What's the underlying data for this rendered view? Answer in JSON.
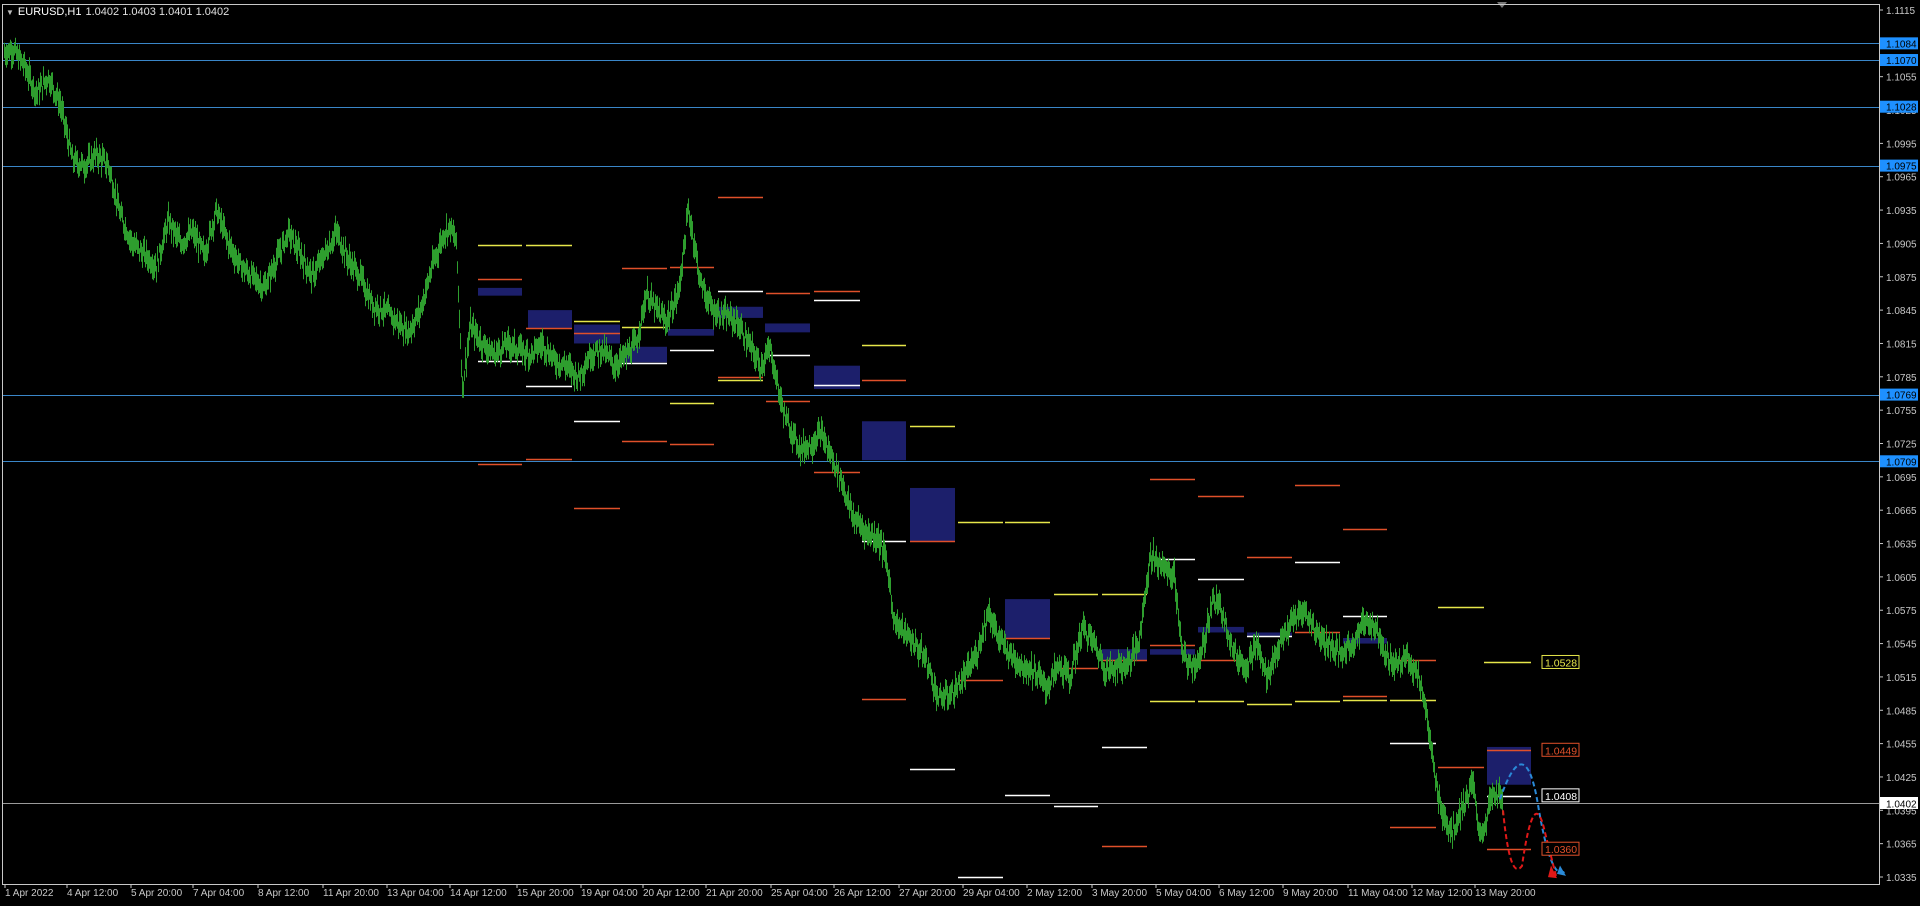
{
  "window": {
    "symbol_period": "EURUSD,H1",
    "ohlc": "1.0402 1.0403 1.0401 1.0402",
    "menu_icon": "dropdown-triangle-icon"
  },
  "colors": {
    "background": "#000000",
    "candles": "#2e9e2e",
    "hline": "#3a86c8",
    "price_tag": "#1e90ff",
    "box": "#1c1f6b",
    "yellow": "#e6e64a",
    "orange": "#e0502a",
    "white": "#ffffff",
    "blue_path": "#2a8ad8",
    "red_path": "#e01818"
  },
  "price_axis": {
    "min": 1.0325,
    "max": 1.1125,
    "ticks": [
      "1.1115",
      "1.1085",
      "1.1055",
      "1.1025",
      "1.0995",
      "1.0965",
      "1.0935",
      "1.0905",
      "1.0875",
      "1.0845",
      "1.0815",
      "1.0785",
      "1.0755",
      "1.0725",
      "1.0695",
      "1.0665",
      "1.0635",
      "1.0605",
      "1.0575",
      "1.0545",
      "1.0515",
      "1.0485",
      "1.0455",
      "1.0425",
      "1.0395",
      "1.0365",
      "1.0335"
    ]
  },
  "time_axis": {
    "labels": [
      "1 Apr 2022",
      "4 Apr 12:00",
      "5 Apr 20:00",
      "7 Apr 04:00",
      "8 Apr 12:00",
      "11 Apr 20:00",
      "13 Apr 04:00",
      "14 Apr 12:00",
      "15 Apr 20:00",
      "19 Apr 04:00",
      "20 Apr 12:00",
      "21 Apr 20:00",
      "25 Apr 04:00",
      "26 Apr 12:00",
      "27 Apr 20:00",
      "29 Apr 04:00",
      "2 May 12:00",
      "3 May 20:00",
      "5 May 04:00",
      "6 May 12:00",
      "9 May 20:00",
      "11 May 04:00",
      "12 May 12:00",
      "13 May 20:00"
    ]
  },
  "horizontal_levels": [
    {
      "price": 1.1085,
      "tag": "1.1084"
    },
    {
      "price": 1.107,
      "tag": "1.1070"
    },
    {
      "price": 1.1028,
      "tag": "1.1028"
    },
    {
      "price": 1.0975,
      "tag": "1.0975"
    },
    {
      "price": 1.0769,
      "tag": "1.0769"
    },
    {
      "price": 1.0709,
      "tag": "1.0709"
    }
  ],
  "current_price": {
    "price": 1.0402,
    "tag": "1.0402"
  },
  "projection_labels": [
    {
      "price": 1.0528,
      "text": "1.0528",
      "color": "#e6e64a"
    },
    {
      "price": 1.0449,
      "text": "1.0449",
      "color": "#e0502a"
    },
    {
      "price": 1.0408,
      "text": "1.0408",
      "color": "#ffffff"
    },
    {
      "price": 1.036,
      "text": "1.0360",
      "color": "#e0502a"
    }
  ],
  "chart_data": {
    "type": "candlestick",
    "instrument": "EURUSD",
    "timeframe": "H1",
    "ylim": [
      1.0325,
      1.1125
    ],
    "price_path": [
      [
        0,
        1.1075
      ],
      [
        12,
        1.108
      ],
      [
        24,
        1.1065
      ],
      [
        36,
        1.104
      ],
      [
        48,
        1.1055
      ],
      [
        60,
        1.103
      ],
      [
        72,
        1.098
      ],
      [
        84,
        1.0975
      ],
      [
        96,
        1.0985
      ],
      [
        108,
        1.0975
      ],
      [
        120,
        1.093
      ],
      [
        132,
        1.0905
      ],
      [
        144,
        1.0895
      ],
      [
        156,
        1.0885
      ],
      [
        168,
        1.0925
      ],
      [
        180,
        1.0905
      ],
      [
        192,
        1.0915
      ],
      [
        204,
        1.0895
      ],
      [
        216,
        1.0935
      ],
      [
        228,
        1.0905
      ],
      [
        240,
        1.0885
      ],
      [
        252,
        1.0875
      ],
      [
        264,
        1.0865
      ],
      [
        276,
        1.089
      ],
      [
        288,
        1.0915
      ],
      [
        300,
        1.0895
      ],
      [
        312,
        1.0875
      ],
      [
        324,
        1.0895
      ],
      [
        336,
        1.0915
      ],
      [
        348,
        1.089
      ],
      [
        360,
        1.0875
      ],
      [
        372,
        1.085
      ],
      [
        384,
        1.0845
      ],
      [
        396,
        1.0835
      ],
      [
        408,
        1.0825
      ],
      [
        420,
        1.0845
      ],
      [
        432,
        1.0885
      ],
      [
        444,
        1.0915
      ],
      [
        450,
        1.092
      ],
      [
        456,
        1.0905
      ],
      [
        462,
        1.0775
      ],
      [
        470,
        1.083
      ],
      [
        482,
        1.0815
      ],
      [
        494,
        1.0805
      ],
      [
        506,
        1.0815
      ],
      [
        518,
        1.081
      ],
      [
        530,
        1.0805
      ],
      [
        542,
        1.0815
      ],
      [
        554,
        1.08
      ],
      [
        566,
        1.0795
      ],
      [
        578,
        1.0785
      ],
      [
        590,
        1.0805
      ],
      [
        602,
        1.081
      ],
      [
        614,
        1.0795
      ],
      [
        626,
        1.0805
      ],
      [
        636,
        1.0815
      ],
      [
        646,
        1.086
      ],
      [
        656,
        1.0845
      ],
      [
        666,
        1.0835
      ],
      [
        678,
        1.086
      ],
      [
        688,
        1.0935
      ],
      [
        694,
        1.0905
      ],
      [
        700,
        1.087
      ],
      [
        712,
        1.0845
      ],
      [
        724,
        1.084
      ],
      [
        736,
        1.0835
      ],
      [
        748,
        1.0815
      ],
      [
        760,
        1.0795
      ],
      [
        770,
        1.081
      ],
      [
        780,
        1.0765
      ],
      [
        786,
        1.0745
      ],
      [
        792,
        1.0735
      ],
      [
        800,
        1.072
      ],
      [
        812,
        1.0725
      ],
      [
        820,
        1.0735
      ],
      [
        830,
        1.0715
      ],
      [
        840,
        1.0695
      ],
      [
        852,
        1.066
      ],
      [
        866,
        1.0645
      ],
      [
        878,
        1.064
      ],
      [
        886,
        1.062
      ],
      [
        894,
        1.0565
      ],
      [
        904,
        1.0555
      ],
      [
        914,
        1.0545
      ],
      [
        926,
        1.053
      ],
      [
        938,
        1.0495
      ],
      [
        952,
        1.05
      ],
      [
        964,
        1.0515
      ],
      [
        976,
        1.0535
      ],
      [
        988,
        1.0575
      ],
      [
        998,
        1.055
      ],
      [
        1010,
        1.0535
      ],
      [
        1022,
        1.0525
      ],
      [
        1034,
        1.052
      ],
      [
        1046,
        1.0505
      ],
      [
        1058,
        1.0525
      ],
      [
        1070,
        1.0515
      ],
      [
        1082,
        1.056
      ],
      [
        1094,
        1.0545
      ],
      [
        1106,
        1.052
      ],
      [
        1116,
        1.0525
      ],
      [
        1126,
        1.0525
      ],
      [
        1138,
        1.0545
      ],
      [
        1150,
        1.0625
      ],
      [
        1162,
        1.0615
      ],
      [
        1174,
        1.0605
      ],
      [
        1182,
        1.0535
      ],
      [
        1190,
        1.0525
      ],
      [
        1200,
        1.053
      ],
      [
        1212,
        1.0585
      ],
      [
        1222,
        1.0575
      ],
      [
        1234,
        1.0535
      ],
      [
        1246,
        1.0525
      ],
      [
        1256,
        1.0545
      ],
      [
        1266,
        1.0515
      ],
      [
        1280,
        1.0545
      ],
      [
        1292,
        1.0565
      ],
      [
        1304,
        1.0575
      ],
      [
        1316,
        1.0555
      ],
      [
        1328,
        1.0545
      ],
      [
        1340,
        1.0535
      ],
      [
        1352,
        1.0545
      ],
      [
        1364,
        1.0565
      ],
      [
        1376,
        1.056
      ],
      [
        1388,
        1.053
      ],
      [
        1398,
        1.0525
      ],
      [
        1406,
        1.0535
      ],
      [
        1418,
        1.0515
      ],
      [
        1424,
        1.0495
      ],
      [
        1432,
        1.044
      ],
      [
        1438,
        1.0405
      ],
      [
        1446,
        1.0385
      ],
      [
        1452,
        1.0375
      ],
      [
        1460,
        1.0395
      ],
      [
        1466,
        1.0405
      ],
      [
        1472,
        1.042
      ],
      [
        1478,
        1.038
      ],
      [
        1484,
        1.0375
      ],
      [
        1490,
        1.0405
      ],
      [
        1496,
        1.041
      ],
      [
        1502,
        1.0405
      ]
    ],
    "boxes": [
      {
        "x1": 478,
        "x2": 522,
        "p1": 1.0865,
        "p2": 1.0858
      },
      {
        "x1": 528,
        "x2": 572,
        "p1": 1.0845,
        "p2": 1.0829
      },
      {
        "x1": 574,
        "x2": 620,
        "p1": 1.0832,
        "p2": 1.0815
      },
      {
        "x1": 624,
        "x2": 667,
        "p1": 1.0812,
        "p2": 1.0798
      },
      {
        "x1": 668,
        "x2": 714,
        "p1": 1.0828,
        "p2": 1.0822
      },
      {
        "x1": 718,
        "x2": 763,
        "p1": 1.0848,
        "p2": 1.0838
      },
      {
        "x1": 765,
        "x2": 810,
        "p1": 1.0833,
        "p2": 1.0825
      },
      {
        "x1": 814,
        "x2": 860,
        "p1": 1.0795,
        "p2": 1.0774
      },
      {
        "x1": 862,
        "x2": 906,
        "p1": 1.0745,
        "p2": 1.071
      },
      {
        "x1": 910,
        "x2": 955,
        "p1": 1.0685,
        "p2": 1.0637
      },
      {
        "x1": 1005,
        "x2": 1050,
        "p1": 1.0585,
        "p2": 1.055
      },
      {
        "x1": 1102,
        "x2": 1147,
        "p1": 1.054,
        "p2": 1.053
      },
      {
        "x1": 1150,
        "x2": 1195,
        "p1": 1.054,
        "p2": 1.0535
      },
      {
        "x1": 1198,
        "x2": 1244,
        "p1": 1.056,
        "p2": 1.0555
      },
      {
        "x1": 1247,
        "x2": 1292,
        "p1": 1.0555,
        "p2": 1.0552
      },
      {
        "x1": 1343,
        "x2": 1387,
        "p1": 1.055,
        "p2": 1.0545
      },
      {
        "x1": 1487,
        "x2": 1531,
        "p1": 1.0452,
        "p2": 1.0418
      }
    ],
    "segments": [
      {
        "x1": 478,
        "x2": 522,
        "p": 1.0904,
        "c": "yellow"
      },
      {
        "x1": 478,
        "x2": 522,
        "p": 1.0873,
        "c": "orange"
      },
      {
        "x1": 478,
        "x2": 522,
        "p": 1.0799,
        "c": "white"
      },
      {
        "x1": 478,
        "x2": 522,
        "p": 1.0707,
        "c": "orange"
      },
      {
        "x1": 526,
        "x2": 572,
        "p": 1.0904,
        "c": "yellow"
      },
      {
        "x1": 526,
        "x2": 572,
        "p": 1.0829,
        "c": "orange"
      },
      {
        "x1": 526,
        "x2": 572,
        "p": 1.0777,
        "c": "white"
      },
      {
        "x1": 526,
        "x2": 572,
        "p": 1.0711,
        "c": "orange"
      },
      {
        "x1": 574,
        "x2": 620,
        "p": 1.0835,
        "c": "yellow"
      },
      {
        "x1": 574,
        "x2": 620,
        "p": 1.0824,
        "c": "orange"
      },
      {
        "x1": 574,
        "x2": 620,
        "p": 1.0745,
        "c": "white"
      },
      {
        "x1": 574,
        "x2": 620,
        "p": 1.0667,
        "c": "orange"
      },
      {
        "x1": 622,
        "x2": 667,
        "p": 1.0883,
        "c": "orange"
      },
      {
        "x1": 622,
        "x2": 667,
        "p": 1.083,
        "c": "yellow"
      },
      {
        "x1": 622,
        "x2": 667,
        "p": 1.0797,
        "c": "white"
      },
      {
        "x1": 622,
        "x2": 667,
        "p": 1.0727,
        "c": "orange"
      },
      {
        "x1": 670,
        "x2": 714,
        "p": 1.0884,
        "c": "orange"
      },
      {
        "x1": 670,
        "x2": 714,
        "p": 1.0809,
        "c": "white"
      },
      {
        "x1": 670,
        "x2": 714,
        "p": 1.0761,
        "c": "yellow"
      },
      {
        "x1": 670,
        "x2": 714,
        "p": 1.0725,
        "c": "orange"
      },
      {
        "x1": 718,
        "x2": 763,
        "p": 1.0947,
        "c": "orange"
      },
      {
        "x1": 718,
        "x2": 763,
        "p": 1.0862,
        "c": "white"
      },
      {
        "x1": 718,
        "x2": 763,
        "p": 1.0785,
        "c": "orange"
      },
      {
        "x1": 718,
        "x2": 763,
        "p": 1.0782,
        "c": "yellow"
      },
      {
        "x1": 766,
        "x2": 810,
        "p": 1.086,
        "c": "orange"
      },
      {
        "x1": 766,
        "x2": 810,
        "p": 1.0805,
        "c": "white"
      },
      {
        "x1": 766,
        "x2": 810,
        "p": 1.0763,
        "c": "orange"
      },
      {
        "x1": 814,
        "x2": 860,
        "p": 1.0862,
        "c": "orange"
      },
      {
        "x1": 814,
        "x2": 860,
        "p": 1.0854,
        "c": "white"
      },
      {
        "x1": 814,
        "x2": 860,
        "p": 1.0778,
        "c": "white"
      },
      {
        "x1": 814,
        "x2": 860,
        "p": 1.0699,
        "c": "orange"
      },
      {
        "x1": 862,
        "x2": 906,
        "p": 1.0814,
        "c": "yellow"
      },
      {
        "x1": 862,
        "x2": 906,
        "p": 1.0782,
        "c": "orange"
      },
      {
        "x1": 862,
        "x2": 906,
        "p": 1.0637,
        "c": "white"
      },
      {
        "x1": 862,
        "x2": 906,
        "p": 1.0495,
        "c": "orange"
      },
      {
        "x1": 910,
        "x2": 955,
        "p": 1.0741,
        "c": "yellow"
      },
      {
        "x1": 910,
        "x2": 955,
        "p": 1.0637,
        "c": "orange"
      },
      {
        "x1": 910,
        "x2": 955,
        "p": 1.0432,
        "c": "white"
      },
      {
        "x1": 958,
        "x2": 1003,
        "p": 1.0654,
        "c": "yellow"
      },
      {
        "x1": 958,
        "x2": 1003,
        "p": 1.0512,
        "c": "orange"
      },
      {
        "x1": 958,
        "x2": 1003,
        "p": 1.0335,
        "c": "white"
      },
      {
        "x1": 1005,
        "x2": 1050,
        "p": 1.0654,
        "c": "yellow"
      },
      {
        "x1": 1005,
        "x2": 1050,
        "p": 1.055,
        "c": "orange"
      },
      {
        "x1": 1005,
        "x2": 1050,
        "p": 1.0409,
        "c": "white"
      },
      {
        "x1": 1054,
        "x2": 1098,
        "p": 1.059,
        "c": "yellow"
      },
      {
        "x1": 1054,
        "x2": 1098,
        "p": 1.0523,
        "c": "orange"
      },
      {
        "x1": 1054,
        "x2": 1098,
        "p": 1.0399,
        "c": "white"
      },
      {
        "x1": 1102,
        "x2": 1147,
        "p": 1.059,
        "c": "yellow"
      },
      {
        "x1": 1102,
        "x2": 1147,
        "p": 1.053,
        "c": "orange"
      },
      {
        "x1": 1102,
        "x2": 1147,
        "p": 1.0452,
        "c": "white"
      },
      {
        "x1": 1102,
        "x2": 1147,
        "p": 1.0363,
        "c": "orange"
      },
      {
        "x1": 1150,
        "x2": 1195,
        "p": 1.0693,
        "c": "orange"
      },
      {
        "x1": 1150,
        "x2": 1195,
        "p": 1.0621,
        "c": "white"
      },
      {
        "x1": 1150,
        "x2": 1195,
        "p": 1.0544,
        "c": "orange"
      },
      {
        "x1": 1150,
        "x2": 1195,
        "p": 1.0493,
        "c": "yellow"
      },
      {
        "x1": 1198,
        "x2": 1244,
        "p": 1.0678,
        "c": "orange"
      },
      {
        "x1": 1198,
        "x2": 1244,
        "p": 1.0603,
        "c": "white"
      },
      {
        "x1": 1198,
        "x2": 1244,
        "p": 1.053,
        "c": "orange"
      },
      {
        "x1": 1198,
        "x2": 1244,
        "p": 1.0493,
        "c": "yellow"
      },
      {
        "x1": 1247,
        "x2": 1292,
        "p": 1.0623,
        "c": "orange"
      },
      {
        "x1": 1247,
        "x2": 1292,
        "p": 1.0552,
        "c": "white"
      },
      {
        "x1": 1247,
        "x2": 1292,
        "p": 1.0491,
        "c": "yellow"
      },
      {
        "x1": 1295,
        "x2": 1340,
        "p": 1.0688,
        "c": "orange"
      },
      {
        "x1": 1295,
        "x2": 1340,
        "p": 1.0618,
        "c": "white"
      },
      {
        "x1": 1295,
        "x2": 1340,
        "p": 1.0555,
        "c": "orange"
      },
      {
        "x1": 1295,
        "x2": 1340,
        "p": 1.0493,
        "c": "yellow"
      },
      {
        "x1": 1343,
        "x2": 1387,
        "p": 1.0648,
        "c": "orange"
      },
      {
        "x1": 1343,
        "x2": 1387,
        "p": 1.057,
        "c": "white"
      },
      {
        "x1": 1343,
        "x2": 1387,
        "p": 1.0498,
        "c": "orange"
      },
      {
        "x1": 1343,
        "x2": 1387,
        "p": 1.0494,
        "c": "yellow"
      },
      {
        "x1": 1390,
        "x2": 1436,
        "p": 1.053,
        "c": "orange"
      },
      {
        "x1": 1390,
        "x2": 1436,
        "p": 1.0494,
        "c": "yellow"
      },
      {
        "x1": 1390,
        "x2": 1436,
        "p": 1.0456,
        "c": "white"
      },
      {
        "x1": 1390,
        "x2": 1436,
        "p": 1.038,
        "c": "orange"
      },
      {
        "x1": 1438,
        "x2": 1484,
        "p": 1.0578,
        "c": "yellow"
      },
      {
        "x1": 1438,
        "x2": 1484,
        "p": 1.0434,
        "c": "orange"
      },
      {
        "x1": 1484,
        "x2": 1531,
        "p": 1.0528,
        "c": "yellow"
      },
      {
        "x1": 1487,
        "x2": 1531,
        "p": 1.0449,
        "c": "orange"
      },
      {
        "x1": 1487,
        "x2": 1531,
        "p": 1.0408,
        "c": "white"
      },
      {
        "x1": 1487,
        "x2": 1531,
        "p": 1.036,
        "c": "orange"
      }
    ]
  }
}
